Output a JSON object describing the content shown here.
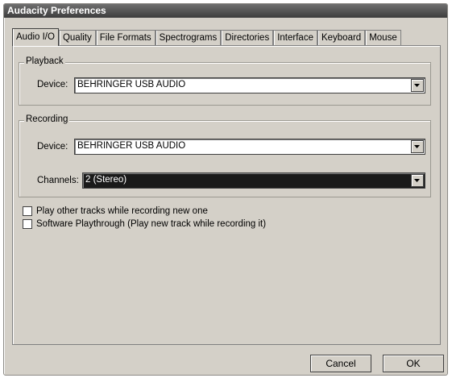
{
  "window": {
    "title": "Audacity Preferences"
  },
  "tabs": [
    {
      "label": "Audio I/O"
    },
    {
      "label": "Quality"
    },
    {
      "label": "File Formats"
    },
    {
      "label": "Spectrograms"
    },
    {
      "label": "Directories"
    },
    {
      "label": "Interface"
    },
    {
      "label": "Keyboard"
    },
    {
      "label": "Mouse"
    }
  ],
  "playback": {
    "title": "Playback",
    "device_label": "Device:",
    "device_value": "BEHRINGER USB AUDIO"
  },
  "recording": {
    "title": "Recording",
    "device_label": "Device:",
    "device_value": "BEHRINGER USB AUDIO",
    "channels_label": "Channels:",
    "channels_value": "2 (Stereo)"
  },
  "options": [
    {
      "label": "Play other tracks while recording new one",
      "checked": false
    },
    {
      "label": "Software Playthrough (Play new track while recording it)",
      "checked": false
    }
  ],
  "buttons": {
    "cancel": "Cancel",
    "ok": "OK"
  },
  "icons": {
    "dropdown": "chevron-down-icon"
  }
}
